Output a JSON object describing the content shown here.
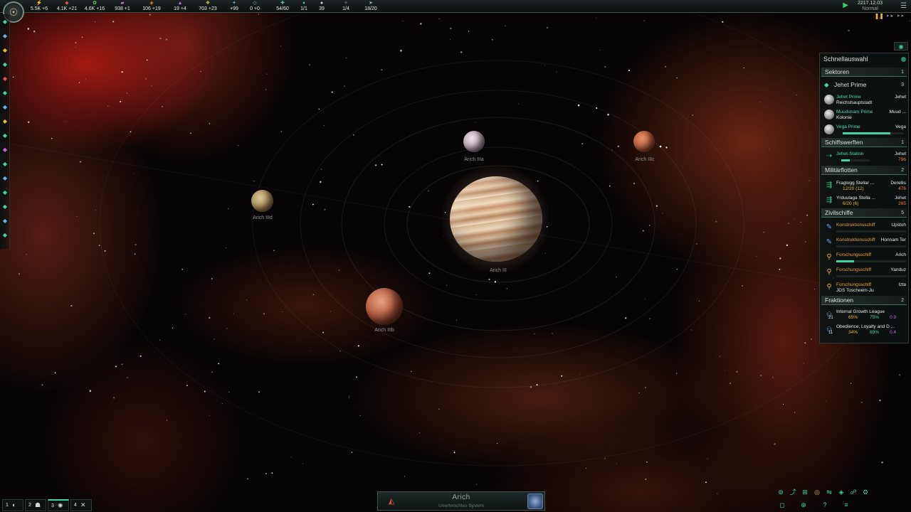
{
  "topbar": {
    "resources": [
      {
        "icon": "energy-icon",
        "glyph": "⚡",
        "color": "#e6c34a",
        "value": "5.5K +6"
      },
      {
        "icon": "minerals-icon",
        "glyph": "◆",
        "color": "#e0524a",
        "value": "4.1K +21"
      },
      {
        "icon": "food-icon",
        "glyph": "✿",
        "color": "#6fd060",
        "value": "4.6K +16"
      },
      {
        "icon": "alloys-icon",
        "glyph": "▰",
        "color": "#c76ad6",
        "value": "938 +1"
      },
      {
        "icon": "consumer-goods-icon",
        "glyph": "◈",
        "color": "#e48a3c",
        "value": "106 +19"
      },
      {
        "icon": "influence-icon",
        "glyph": "▲",
        "color": "#c46ae0",
        "value": "19 +4"
      },
      {
        "icon": "unity-icon",
        "glyph": "❖",
        "color": "#d6c25a",
        "value": "703 +23"
      },
      {
        "icon": "research-icon",
        "glyph": "✦",
        "color": "#6ab0e8",
        "value": "+99"
      },
      {
        "icon": "rare-resource-icon",
        "glyph": "◇",
        "color": "#a0b8b0",
        "value": "0 +0"
      },
      {
        "icon": "empire-sprawl-icon",
        "glyph": "✚",
        "color": "#58c0a8",
        "value": "54/60"
      },
      {
        "icon": "envoys-icon",
        "glyph": "♦",
        "color": "#58c0a8",
        "value": "1/1"
      },
      {
        "icon": "pops-icon",
        "glyph": "●",
        "color": "#d0d8d4",
        "value": "39"
      },
      {
        "icon": "starbases-icon",
        "glyph": "✧",
        "color": "#a0b0b0",
        "value": "1/4"
      },
      {
        "icon": "fleet-capacity-icon",
        "glyph": "➤",
        "color": "#a0b0b0",
        "value": "18/20"
      }
    ],
    "date": "2217.12.03",
    "speed_label": "Normal"
  },
  "left_bar_icons": [
    "situation-log-icon",
    "contacts-icon",
    "government-icon",
    "planets-icon",
    "ships-icon",
    "expansion-icon",
    "technology-icon",
    "traditions-icon",
    "species-icon",
    "policies-icon",
    "edicts-icon",
    "galactic-market-icon",
    "intel-icon",
    "factions-icon",
    "relics-icon",
    "expand-icon"
  ],
  "system": {
    "planets": [
      {
        "name": "Arich IIIa"
      },
      {
        "name": "Arich IIIc"
      },
      {
        "name": "Arich IIId"
      },
      {
        "name": "Arich III"
      },
      {
        "name": "Arich IIIb"
      }
    ],
    "name": "Arich",
    "status": "Unerforschtes System"
  },
  "outliner": {
    "title": "Schnellauswahl",
    "sections": {
      "sectors": {
        "label": "Sektoren",
        "count": "1"
      },
      "sector_name": {
        "label": "Jehet Prime",
        "count": "3"
      },
      "planets": [
        {
          "name": "Jehet Prime",
          "sub": "Reichshauptstadt",
          "right": "Jehet"
        },
        {
          "name": "Muudstram Prime",
          "sub": "Kolonie",
          "right": "Muud ..."
        },
        {
          "name": "Vega Prime",
          "sub": "",
          "right": "Vega",
          "progress": 0.78
        }
      ],
      "shipyards": {
        "label": "Schiffswerften",
        "count": "1"
      },
      "shipyard_items": [
        {
          "name": "Jehet-Station",
          "right": "Jehet",
          "right2": "796",
          "progress": 0.3
        }
      ],
      "fleets": {
        "label": "Militärflotten",
        "count": "2"
      },
      "fleet_items": [
        {
          "name": "Fraglogg Stellar ...",
          "sub": "12/20 (12)",
          "right": "Derellis",
          "right2": "476"
        },
        {
          "name": "Yrduulaga Stella ...",
          "sub": "6/20 (6)",
          "right": "Jehet",
          "right2": "265"
        }
      ],
      "civilian": {
        "label": "Zivilschiffe",
        "count": "5"
      },
      "civilian_items": [
        {
          "name": "Konstruktionsschiff",
          "right": "Upstoh",
          "icon": "construction-ship-icon",
          "progress": 0.0
        },
        {
          "name": "Konstruktionsschiff",
          "right": "Honnam Ter",
          "icon": "construction-ship-icon",
          "progress": 0.0
        },
        {
          "name": "Forschungsschiff",
          "right": "Arich",
          "icon": "science-ship-icon",
          "progress": 0.25
        },
        {
          "name": "Forschungsschiff",
          "right": "Yanduz",
          "icon": "science-ship-icon",
          "progress": 0.0
        },
        {
          "name": "Forschungsschiff",
          "sub": "JDS Toscheem-Ju",
          "right": "Izta",
          "icon": "science-ship-icon"
        }
      ],
      "factions": {
        "label": "Fraktionen",
        "count": "2"
      },
      "faction_items": [
        {
          "name": "Internal Growth League",
          "members": "21",
          "support": "65%",
          "approval": "75%",
          "influence": "0.9"
        },
        {
          "name": "Obedience, Loyalty and D ...",
          "members": "11",
          "support": "34%",
          "approval": "69%",
          "influence": "0.4"
        }
      ]
    }
  },
  "bottom_left": [
    {
      "num": "1",
      "icon": "planet-view-icon",
      "glyph": "◐"
    },
    {
      "num": "2",
      "icon": "fleet-view-icon",
      "glyph": "☗"
    },
    {
      "num": "3",
      "icon": "science-view-icon",
      "glyph": "✺"
    },
    {
      "num": "4",
      "icon": "construction-view-icon",
      "glyph": "✕"
    }
  ],
  "bottom_right_icons": [
    "galaxy-map-icon",
    "hyperlanes-icon",
    "borders-icon",
    "targeting-icon",
    "diplomacy-icon",
    "chat-icon",
    "network-icon",
    "options-icon",
    "system-view-icon",
    "zoom-icon",
    "help-icon",
    "menu-icon"
  ]
}
